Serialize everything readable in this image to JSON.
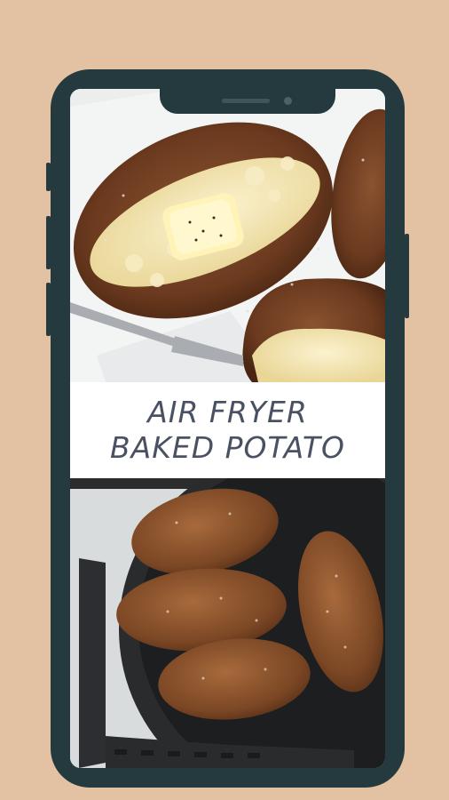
{
  "recipe": {
    "title_line1": "AIR FRYER",
    "title_line2": "BAKED POTATO"
  },
  "images": {
    "top_photo": "baked-potato-with-butter",
    "bottom_photo": "potatoes-in-air-fryer-basket"
  },
  "colors": {
    "background": "#e3c2a4",
    "phone_frame": "#243a3f",
    "title_text": "#4a5163"
  }
}
